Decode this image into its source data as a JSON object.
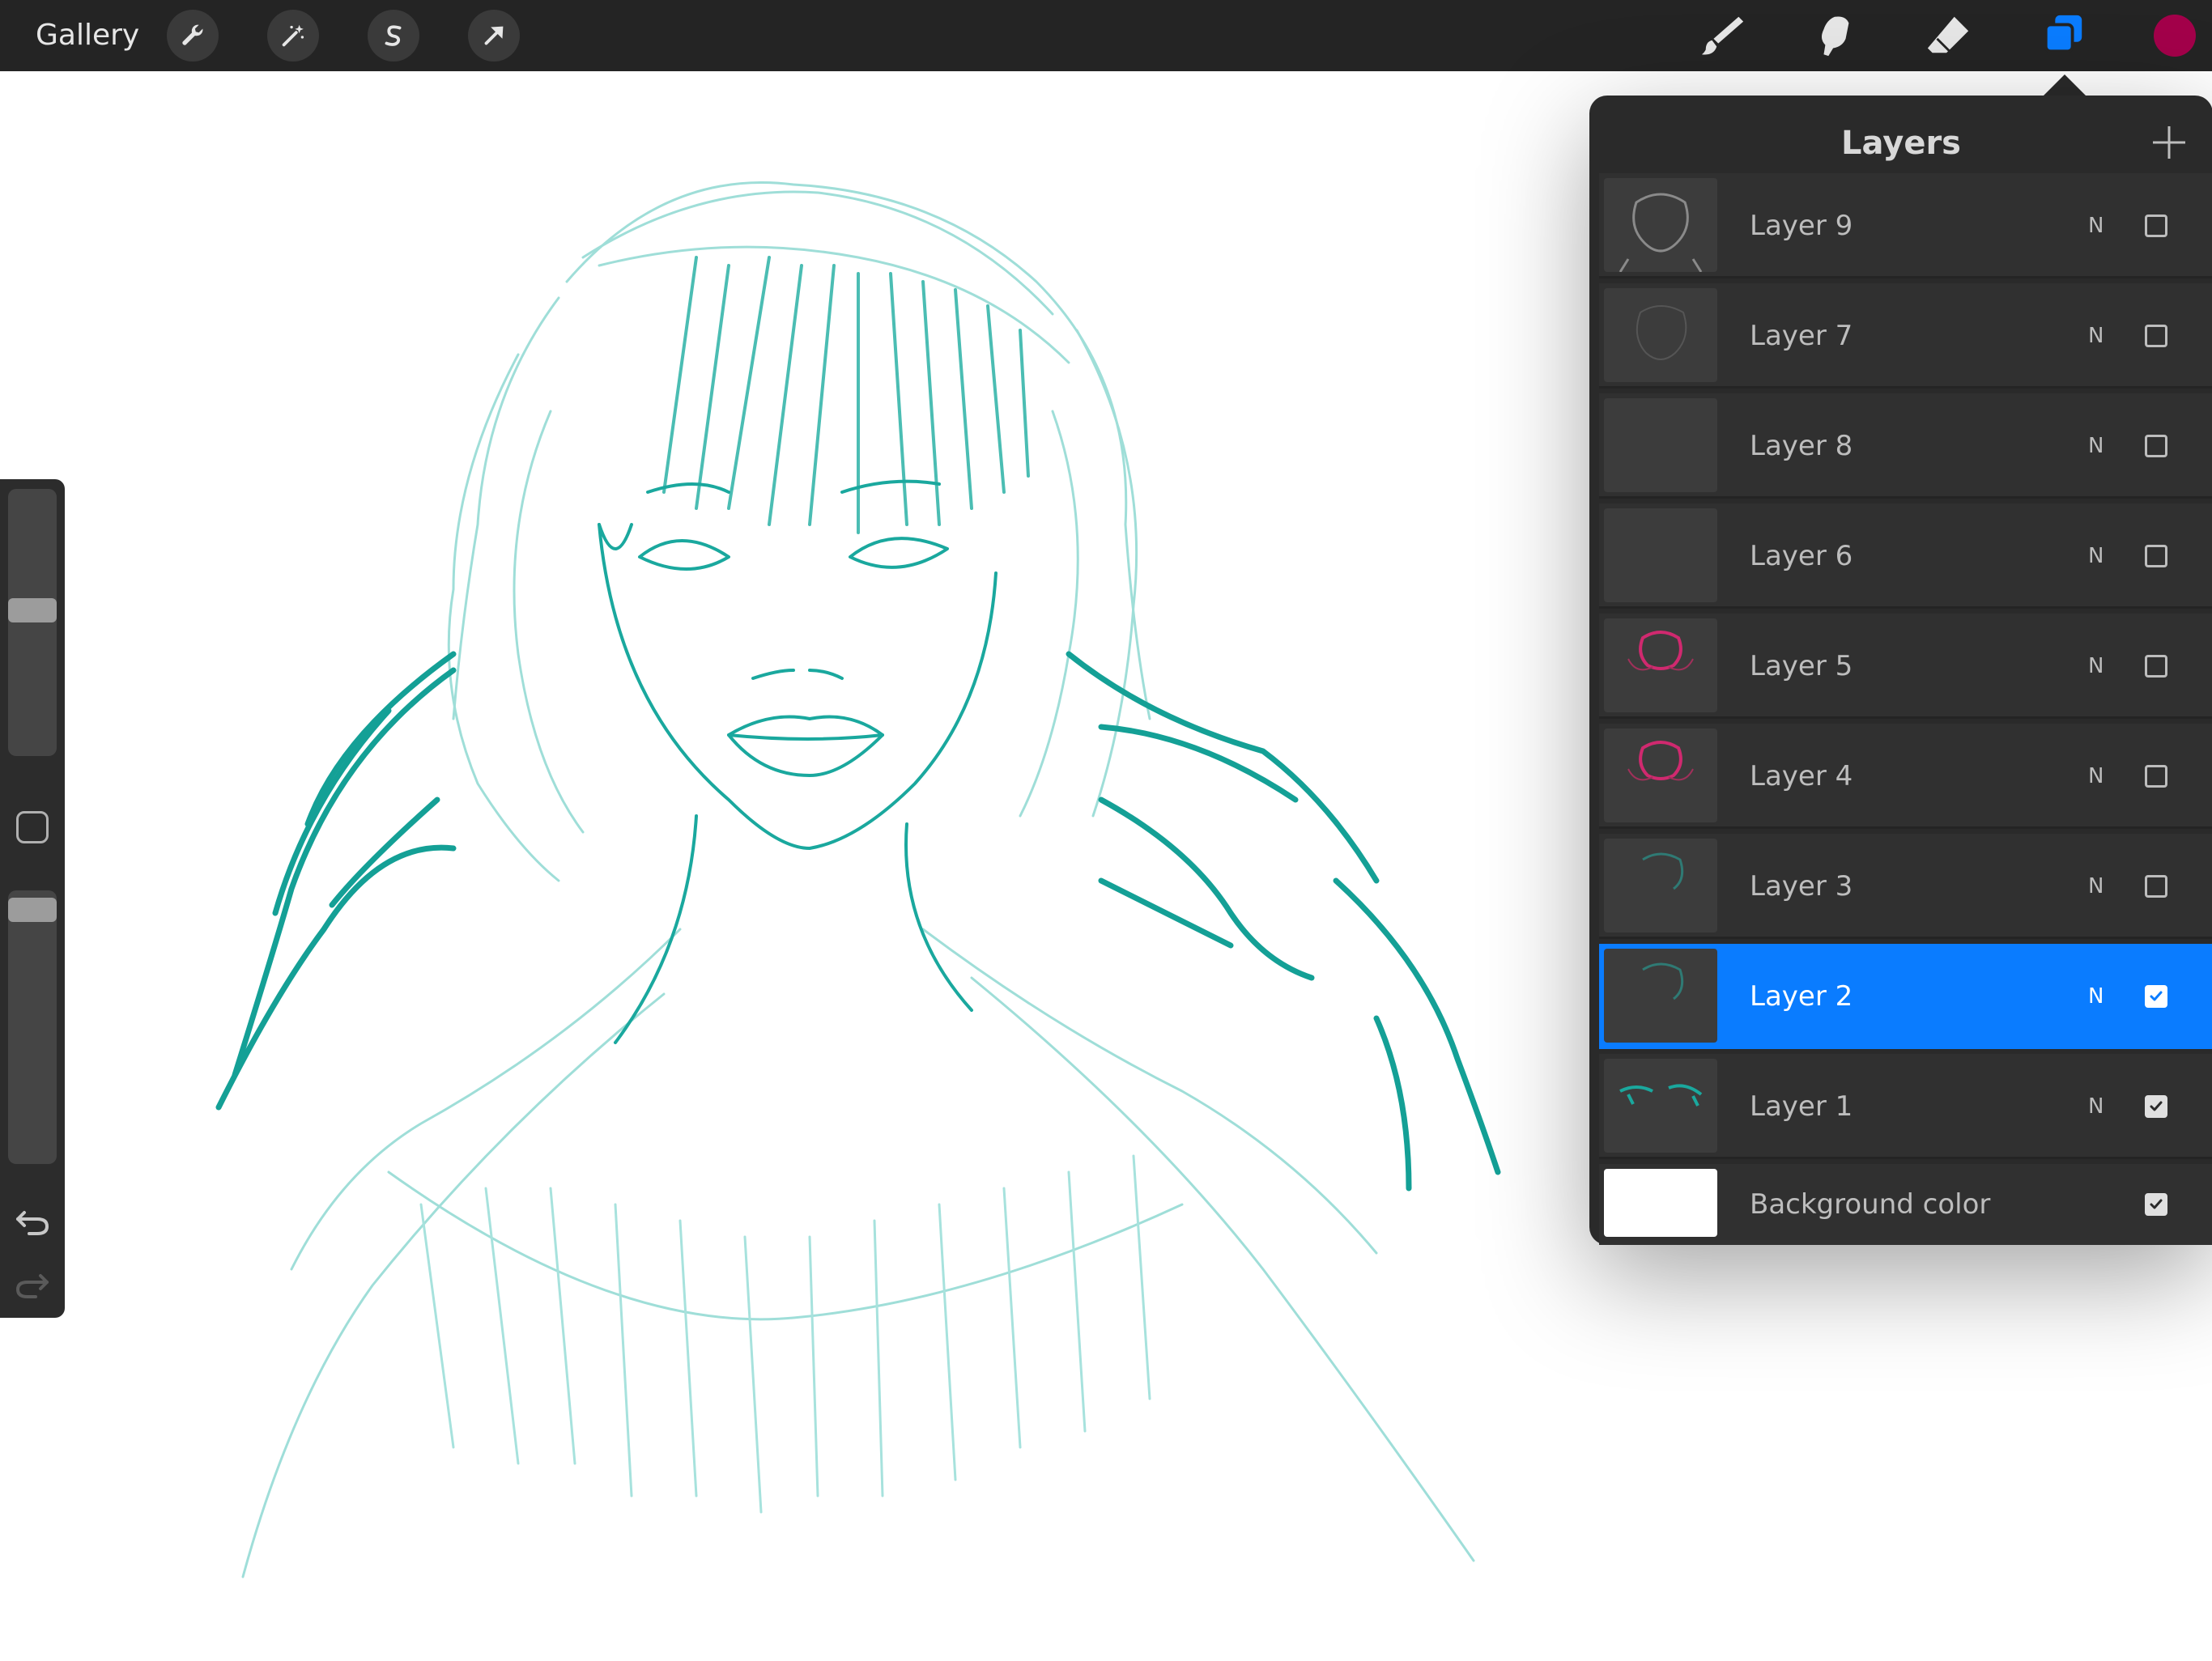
{
  "topbar": {
    "gallery_label": "Gallery",
    "left_tools": [
      {
        "name": "actions-wrench-icon"
      },
      {
        "name": "adjustments-wand-icon"
      },
      {
        "name": "selection-s-icon"
      },
      {
        "name": "transform-arrow-icon"
      }
    ],
    "right_tools": [
      {
        "name": "brush-icon"
      },
      {
        "name": "smudge-icon"
      },
      {
        "name": "eraser-icon"
      },
      {
        "name": "layers-icon",
        "active": true
      }
    ],
    "current_color": "#a3004a",
    "accent_color": "#0a7cff"
  },
  "sidebar": {
    "brush_size_level": 0.55,
    "opacity_level": 0.97
  },
  "layers_panel": {
    "title": "Layers",
    "layers": [
      {
        "name": "Layer 9",
        "blend": "N",
        "visible": false,
        "selected": false,
        "thumb": "gray-sketch"
      },
      {
        "name": "Layer 7",
        "blend": "N",
        "visible": false,
        "selected": false,
        "thumb": "faint-sketch"
      },
      {
        "name": "Layer 8",
        "blend": "N",
        "visible": false,
        "selected": false,
        "thumb": "empty"
      },
      {
        "name": "Layer 6",
        "blend": "N",
        "visible": false,
        "selected": false,
        "thumb": "empty"
      },
      {
        "name": "Layer 5",
        "blend": "N",
        "visible": false,
        "selected": false,
        "thumb": "pink-sketch"
      },
      {
        "name": "Layer 4",
        "blend": "N",
        "visible": false,
        "selected": false,
        "thumb": "pink-sketch"
      },
      {
        "name": "Layer 3",
        "blend": "N",
        "visible": false,
        "selected": false,
        "thumb": "teal-faint"
      },
      {
        "name": "Layer 2",
        "blend": "N",
        "visible": true,
        "selected": true,
        "thumb": "teal-faint"
      },
      {
        "name": "Layer 1",
        "blend": "N",
        "visible": true,
        "selected": false,
        "thumb": "teal-sketch"
      }
    ],
    "background": {
      "name": "Background color",
      "visible": true,
      "color": "#ffffff"
    }
  },
  "canvas": {
    "sketch_color": "#1aa89e",
    "sketch_color_light": "#7fd3cc"
  }
}
